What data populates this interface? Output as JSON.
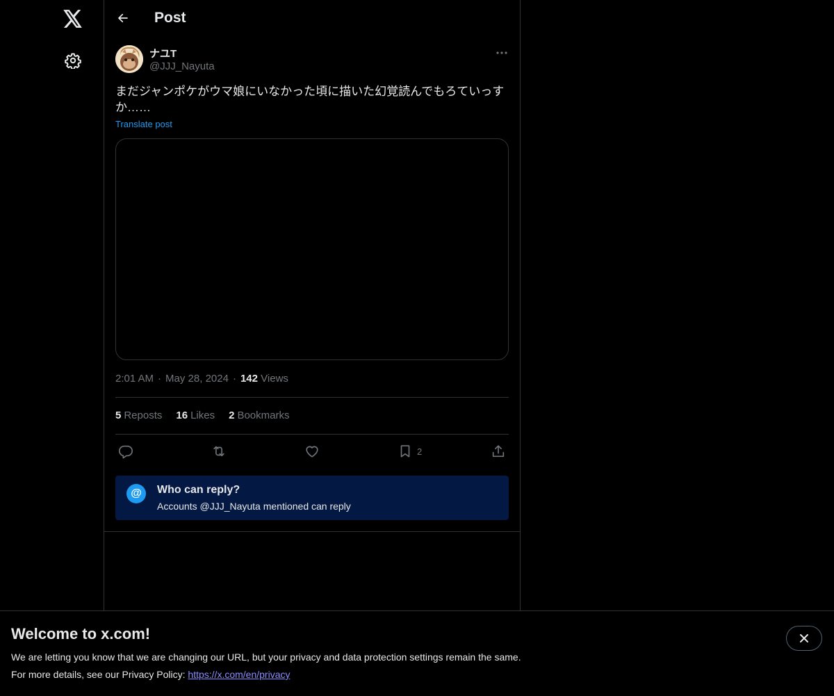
{
  "header": {
    "title": "Post"
  },
  "post": {
    "display_name": "ナユT",
    "handle": "@JJJ_Nayuta",
    "text": "まだジャンポケがウマ娘にいなかった頃に描いた幻覚読んでもろていっすか……",
    "translate_label": "Translate post",
    "time": "2:01 AM",
    "date": "May 28, 2024",
    "views_count": "142",
    "views_label": "Views",
    "reposts_count": "5",
    "reposts_label": "Reposts",
    "likes_count": "16",
    "likes_label": "Likes",
    "bookmarks_count": "2",
    "bookmarks_label": "Bookmarks",
    "bookmark_action_count": "2"
  },
  "reply_restriction": {
    "icon_symbol": "@",
    "title": "Who can reply?",
    "subtitle": "Accounts @JJJ_Nayuta mentioned can reply"
  },
  "banner": {
    "title": "Welcome to x.com!",
    "line1": "We are letting you know that we are changing our URL, but your privacy and data protection settings remain the same.",
    "line2_prefix": "For more details, see our Privacy Policy: ",
    "link": "https://x.com/en/privacy"
  },
  "icons": {
    "logo": "x-logo-icon",
    "settings": "gear-icon",
    "back": "back-arrow-icon",
    "more": "more-dots-icon",
    "reply": "reply-icon",
    "repost": "repost-icon",
    "like": "heart-icon",
    "bookmark": "bookmark-icon",
    "share": "share-icon",
    "close": "close-icon"
  },
  "colors": {
    "background": "#000000",
    "text": "#e7e9ea",
    "muted": "#71767b",
    "accent": "#1d9bf0",
    "reply_box": "#031842",
    "link": "#8a8cff"
  }
}
